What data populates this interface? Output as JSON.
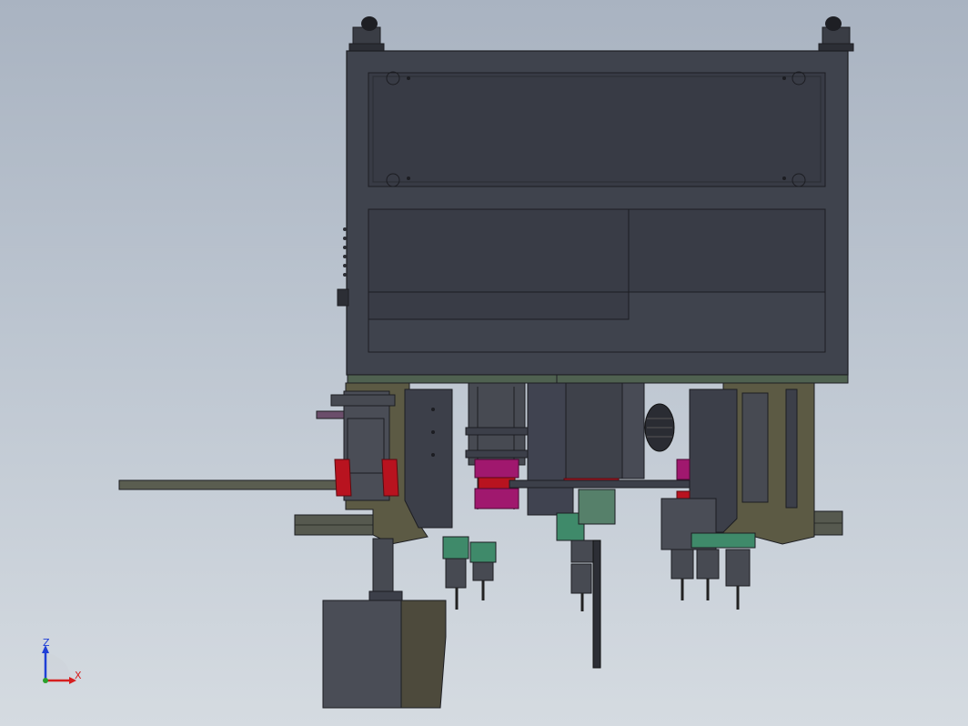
{
  "view": {
    "title": "",
    "background_top": "#a9b3c1",
    "background_bottom": "#d5dbe1"
  },
  "triad": {
    "z_label": "Z",
    "x_label": "X",
    "z_color": "#1f3fd6",
    "x_color": "#d61f1f",
    "origin_color": "#2aa02a"
  },
  "colors": {
    "frame": "#3f434d",
    "frame_dark": "#30333b",
    "panel": "#3a3e48",
    "panel_light": "#4a4e58",
    "plate_green": "#4f6150",
    "olive": "#5c5a44",
    "magenta": "#a0186e",
    "red": "#b8131f",
    "teal": "#3f8a6a",
    "rail": "#5a5d56",
    "housing": "#4a4d56",
    "housing_side": "#4d4a3c"
  },
  "parts": [
    "frame-top",
    "carriage-plate",
    "left-actuator",
    "center-motor",
    "right-actuator",
    "left-rail",
    "right-rail",
    "bottom-housing"
  ]
}
